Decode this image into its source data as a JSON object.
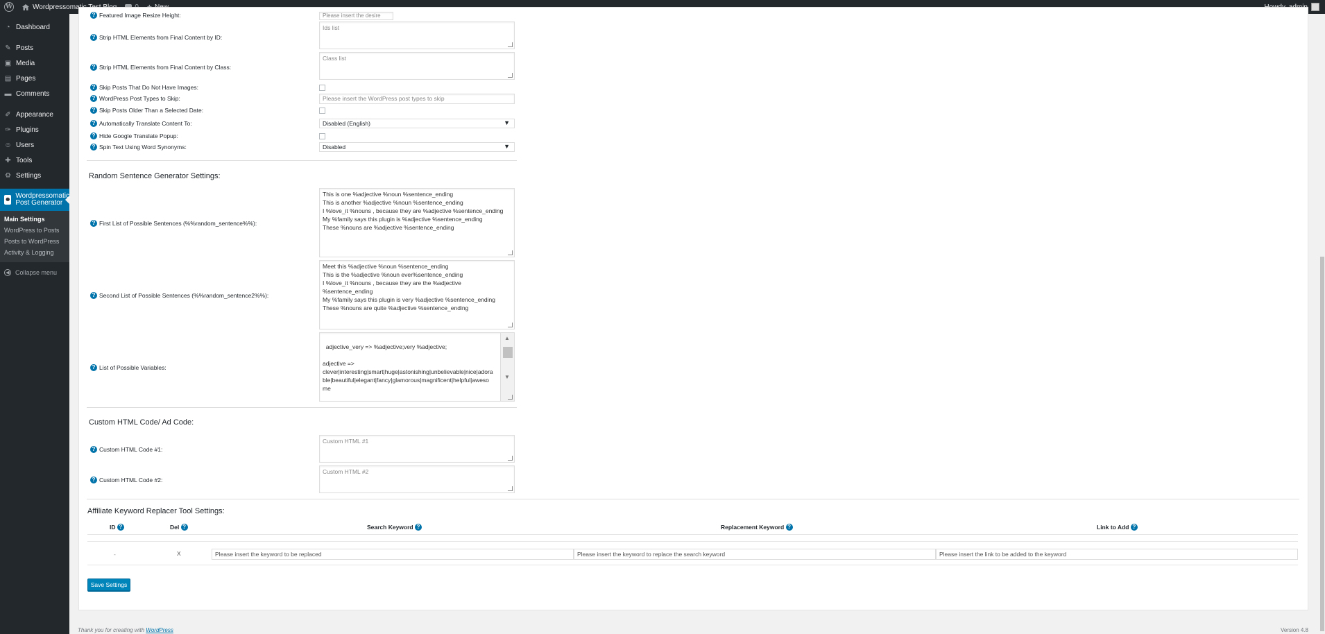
{
  "adminbar": {
    "site_name": "Wordpressomatic Test Blog",
    "comments_count": "0",
    "new_label": "New",
    "howdy": "Howdy, admin"
  },
  "sidebar": {
    "items": [
      {
        "label": "Dashboard",
        "icon": "dashboard-icon"
      },
      {
        "label": "Posts",
        "icon": "pin-icon"
      },
      {
        "label": "Media",
        "icon": "media-icon"
      },
      {
        "label": "Pages",
        "icon": "pages-icon"
      },
      {
        "label": "Comments",
        "icon": "comments-icon"
      },
      {
        "label": "Appearance",
        "icon": "brush-icon"
      },
      {
        "label": "Plugins",
        "icon": "plug-icon"
      },
      {
        "label": "Users",
        "icon": "users-icon"
      },
      {
        "label": "Tools",
        "icon": "wrench-icon"
      },
      {
        "label": "Settings",
        "icon": "settings-icon"
      }
    ],
    "plugin_line1": "Wordpressomatic",
    "plugin_line2": "Post Generator",
    "submenu": [
      "Main Settings",
      "WordPress to Posts",
      "Posts to WordPress",
      "Activity & Logging"
    ],
    "collapse": "Collapse menu"
  },
  "settings": {
    "featured_height_label": "Featured Image Resize Height:",
    "featured_height_placeholder": "Please insert the desire",
    "strip_id_label": "Strip HTML Elements from Final Content by ID:",
    "strip_id_placeholder": "Ids list",
    "strip_class_label": "Strip HTML Elements from Final Content by Class:",
    "strip_class_placeholder": "Class list",
    "skip_no_images_label": "Skip Posts That Do Not Have Images:",
    "post_types_label": "WordPress Post Types to Skip:",
    "post_types_placeholder": "Please insert the WordPress post types to skip",
    "skip_older_label": "Skip Posts Older Than a Selected Date:",
    "translate_label": "Automatically Translate Content To:",
    "translate_value": "Disabled (English)",
    "hide_translate_label": "Hide Google Translate Popup:",
    "spin_label": "Spin Text Using Word Synonyms:",
    "spin_value": "Disabled"
  },
  "random": {
    "title": "Random Sentence Generator Settings:",
    "first_label": "First List of Possible Sentences (%%random_sentence%%):",
    "first_value": "This is one %adjective %noun %sentence_ending\nThis is another %adjective %noun %sentence_ending\nI %love_it %nouns , because they are %adjective %sentence_ending\nMy %family says this plugin is %adjective %sentence_ending\nThese %nouns are %adjective %sentence_ending",
    "second_label": "Second List of Possible Sentences (%%random_sentence2%%):",
    "second_value": "Meet this %adjective %noun %sentence_ending\nThis is the %adjective %noun ever%sentence_ending\nI %love_it %nouns , because they are the %adjective\n%sentence_ending\nMy %family says this plugin is very %adjective %sentence_ending\nThese %nouns are quite %adjective %sentence_ending",
    "vars_label": "List of Possible Variables:",
    "vars_value": "adjective_very => %adjective;very %adjective;\n\nadjective =>\nclever|interesting|smart|huge|astonishing|unbelievable|nice|adora\nble|beautiful|elegant|fancy|glamorous|magnificent|helpful|aweso\nme\n\nnoun_with_adjective => %noun;%adjective %noun"
  },
  "custom_html": {
    "title": "Custom HTML Code/ Ad Code:",
    "code1_label": "Custom HTML Code #1:",
    "code1_placeholder": "Custom HTML #1",
    "code2_label": "Custom HTML Code #2:",
    "code2_placeholder": "Custom HTML #2"
  },
  "affiliate": {
    "title": "Affiliate Keyword Replacer Tool Settings:",
    "col_id": "ID",
    "col_del": "Del",
    "col_search": "Search Keyword",
    "col_replacement": "Replacement Keyword",
    "col_link": "Link to Add",
    "row_id": "-",
    "row_del": "X",
    "search_placeholder": "Please insert the keyword to be replaced",
    "replacement_placeholder": "Please insert the keyword to replace the search keyword",
    "link_placeholder": "Please insert the link to be added to the keyword"
  },
  "save_label": "Save Settings",
  "footer": {
    "text": "Thank you for creating with ",
    "link": "WordPress",
    "version": "Version 4.8"
  },
  "colors": {
    "adminbar": "#23282d",
    "accent": "#0073aa",
    "button": "#0085ba"
  }
}
